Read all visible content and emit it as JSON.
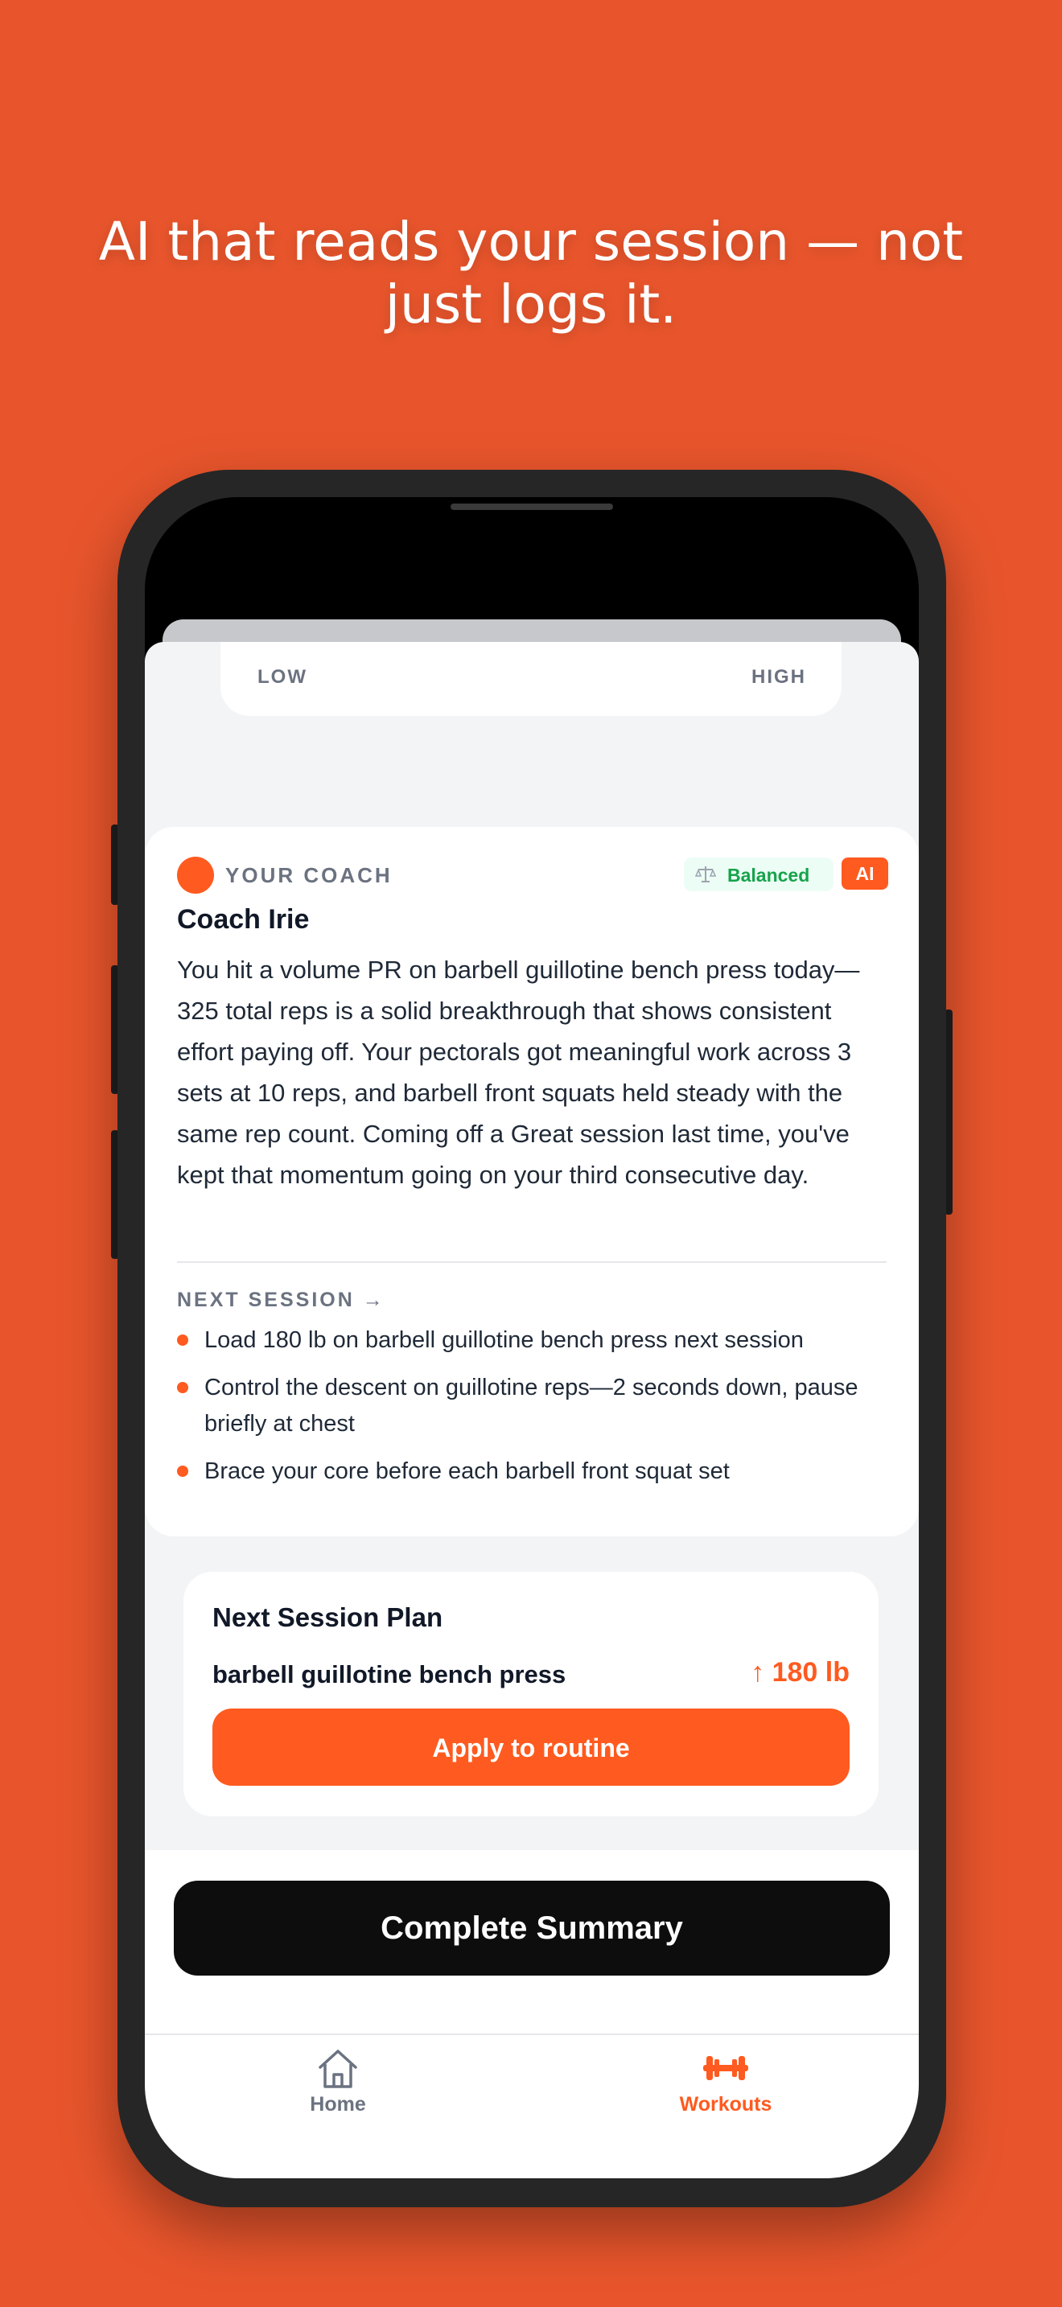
{
  "headline": "AI that reads your session — not just logs it.",
  "intensity": {
    "low_label": "LOW",
    "high_label": "HIGH"
  },
  "coach": {
    "section_label": "YOUR COACH",
    "mode_badge": "Balanced",
    "ai_badge": "AI",
    "name": "Coach Irie",
    "message": "You hit a volume PR on barbell guillotine bench press today—325 total reps is a solid breakthrough that shows consistent effort paying off. Your pectorals got meaningful work across 3 sets at 10 reps, and barbell front squats held steady with the same rep count. Coming off a Great session last time, you've kept that momentum going on your third consecutive day.",
    "next_session_label": "NEXT SESSION →",
    "tips": [
      "Load 180 lb on barbell guillotine bench press next session",
      "Control the descent on guillotine reps—2 seconds down, pause briefly at chest",
      "Brace your core before each barbell front squat set"
    ]
  },
  "plan": {
    "title": "Next Session Plan",
    "exercise": "barbell guillotine bench press",
    "weight": "↑ 180 lb",
    "apply_label": "Apply to routine"
  },
  "summary_button": "Complete Summary",
  "tabs": [
    {
      "label": "Home",
      "icon": "home-icon"
    },
    {
      "label": "Workouts",
      "icon": "dumbbell-icon"
    }
  ],
  "colors": {
    "background": "#E8552C",
    "accent": "#FF5A1F",
    "positive": "#16A34A",
    "dark_button": "#0D0D0D"
  }
}
